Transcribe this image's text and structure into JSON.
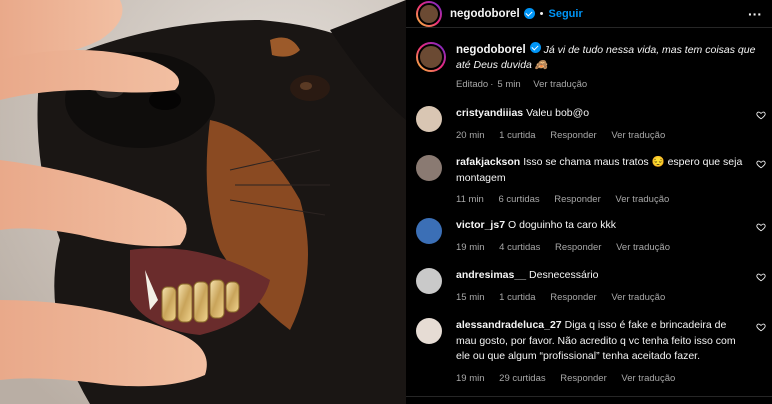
{
  "post": {
    "author": "negodoborel",
    "follow_label": "Seguir",
    "more_label": "···"
  },
  "caption": {
    "user": "negodoborel",
    "text": "Já vi de tudo nessa vida, mas tem coisas que até Deus duvida 🙈",
    "edited": "Editado",
    "time": "5 min",
    "translate": "Ver tradução"
  },
  "comments": [
    {
      "user": "cristyandiiias",
      "text": "Valeu bob@o",
      "time": "20 min",
      "likes": "1 curtida",
      "reply": "Responder",
      "translate": "Ver tradução",
      "avatar_color": "#d9c6b3"
    },
    {
      "user": "rafakjackson",
      "text": "Isso se chama maus tratos 😔  espero que seja montagem",
      "time": "11 min",
      "likes": "6 curtidas",
      "reply": "Responder",
      "translate": "Ver tradução",
      "avatar_color": "#8a7a72"
    },
    {
      "user": "victor_js7",
      "text": "O doguinho ta caro kkk",
      "time": "19 min",
      "likes": "4 curtidas",
      "reply": "Responder",
      "translate": "Ver tradução",
      "avatar_color": "#3b6fb6"
    },
    {
      "user": "andresimas__",
      "text": "Desnecessário",
      "time": "15 min",
      "likes": "1 curtida",
      "reply": "Responder",
      "translate": "Ver tradução",
      "avatar_color": "#c9c9c9"
    },
    {
      "user": "alessandradeluca_27",
      "text": "Diga q isso é fake e brincadeira de mau gosto, por favor. Não acredito q vc tenha feito isso com ele ou que algum “profissional” tenha aceitado fazer.",
      "time": "19 min",
      "likes": "29 curtidas",
      "reply": "Responder",
      "translate": "Ver tradução",
      "avatar_color": "#e6dcd4"
    }
  ],
  "colors": {
    "accent": "#0095f6",
    "muted": "#a8a8a8",
    "background": "#000000"
  },
  "icons": {
    "verified": "verified-badge-icon",
    "heart": "heart-icon",
    "more": "more-options-icon"
  }
}
